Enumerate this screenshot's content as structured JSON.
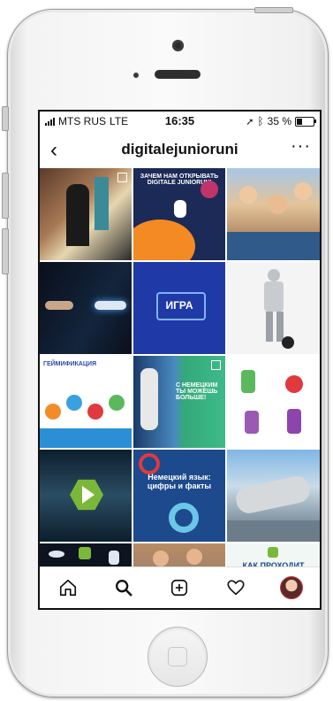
{
  "status": {
    "carrier": "MTS RUS",
    "network": "LTE",
    "time": "16:35",
    "battery_text": "35 %",
    "battery_fill": 0.35
  },
  "header": {
    "back_icon": "chevron-left-icon",
    "username": "digitalejunioruni",
    "more_icon": "more-dots-icon"
  },
  "posts": [
    {
      "theme": "graduation-photo",
      "caption": ""
    },
    {
      "theme": "space-astronaut",
      "caption": "ЗАЧЕМ НАМ ОТКРЫВАТЬ DIGITALE JUNIORUNI"
    },
    {
      "theme": "students-selfie",
      "caption": ""
    },
    {
      "theme": "robot-hand",
      "caption": ""
    },
    {
      "theme": "game-circuit",
      "caption": "ИГРА"
    },
    {
      "theme": "humanoid-robot",
      "caption": ""
    },
    {
      "theme": "gamification",
      "caption": "ГЕЙМИФИКАЦИЯ"
    },
    {
      "theme": "lab-experiment",
      "caption": "С НЕМЕЦКИМ ТЫ МОЖЕШЬ БОЛЬШЕ!"
    },
    {
      "theme": "cartoon-robots",
      "caption": ""
    },
    {
      "theme": "video-play",
      "caption": ""
    },
    {
      "theme": "german-facts",
      "caption": "Немецкий язык: цифры и факты"
    },
    {
      "theme": "industrial-machine",
      "caption": ""
    },
    {
      "theme": "ufo-space",
      "caption": ""
    },
    {
      "theme": "people-group",
      "caption": ""
    },
    {
      "theme": "how-it-works",
      "caption": "КАК ПРОХОДИТ"
    }
  ],
  "tabbar": [
    {
      "icon": "home-icon"
    },
    {
      "icon": "search-icon"
    },
    {
      "icon": "new-post-icon"
    },
    {
      "icon": "heart-icon"
    },
    {
      "icon": "profile-avatar"
    }
  ]
}
